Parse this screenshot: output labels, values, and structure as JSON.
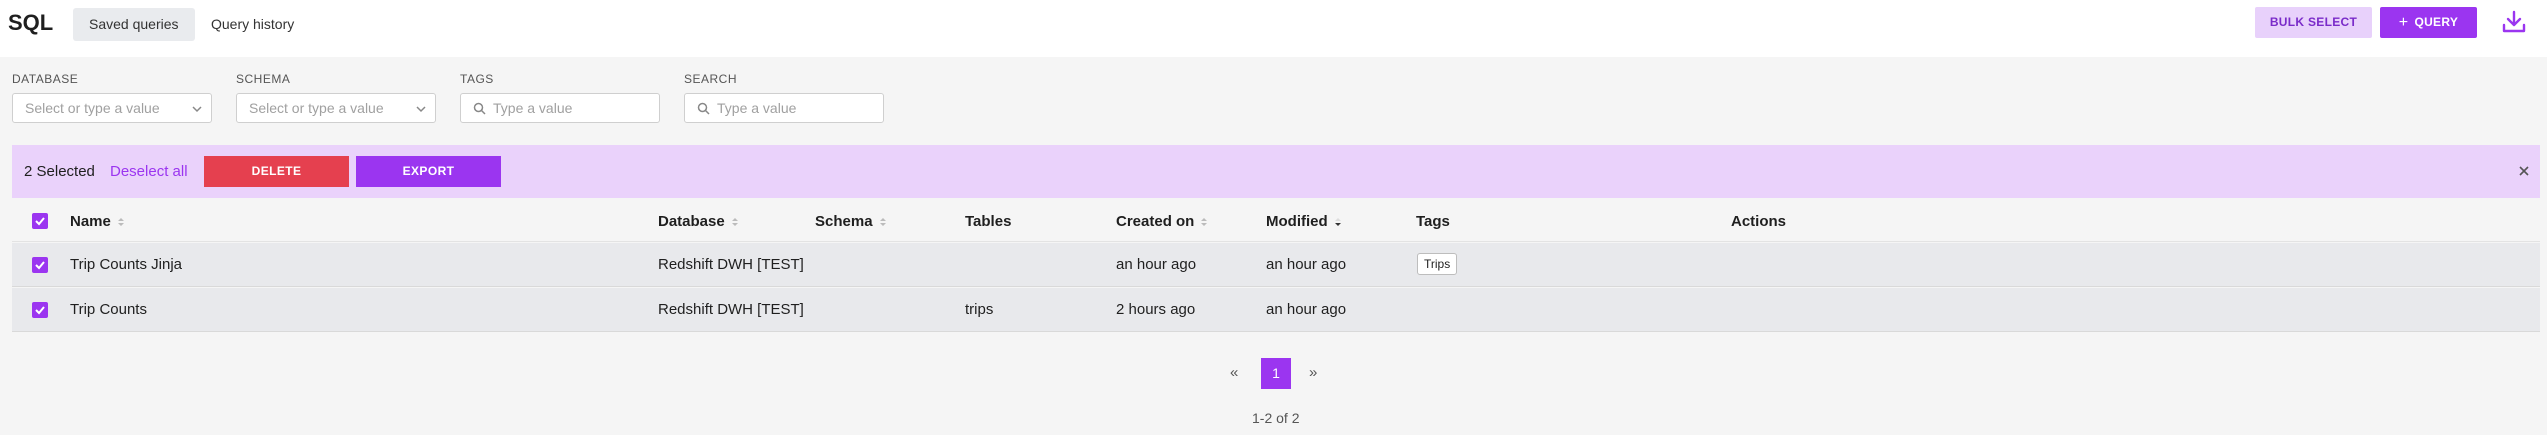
{
  "header": {
    "title": "SQL",
    "tabs": [
      {
        "label": "Saved queries",
        "active": true
      },
      {
        "label": "Query history",
        "active": false
      }
    ],
    "bulk_select_label": "BULK SELECT",
    "query_label": "QUERY",
    "download_icon": "download-icon"
  },
  "filters": {
    "database": {
      "label": "DATABASE",
      "placeholder": "Select or type a value"
    },
    "schema": {
      "label": "SCHEMA",
      "placeholder": "Select or type a value"
    },
    "tags": {
      "label": "TAGS",
      "placeholder": "Type a value"
    },
    "search": {
      "label": "SEARCH",
      "placeholder": "Type a value"
    }
  },
  "selection": {
    "count_text": "2 Selected",
    "deselect_label": "Deselect all",
    "delete_label": "DELETE",
    "export_label": "EXPORT"
  },
  "table": {
    "columns": [
      "Name",
      "Database",
      "Schema",
      "Tables",
      "Created on",
      "Modified",
      "Tags",
      "Actions"
    ],
    "rows": [
      {
        "name": "Trip Counts Jinja",
        "database": "Redshift DWH [TEST]",
        "schema": "",
        "tables": "",
        "created_on": "an hour ago",
        "modified": "an hour ago",
        "tags": "Trips",
        "selected": true
      },
      {
        "name": "Trip Counts",
        "database": "Redshift DWH [TEST]",
        "schema": "",
        "tables": "trips",
        "created_on": "2 hours ago",
        "modified": "an hour ago",
        "tags": "",
        "selected": true
      }
    ]
  },
  "pagination": {
    "prev": "«",
    "page": "1",
    "next": "»",
    "range": "1-2 of 2"
  },
  "colors": {
    "accent": "#9b35f0",
    "danger": "#e5404f",
    "selection_bg": "#ead2fb"
  }
}
